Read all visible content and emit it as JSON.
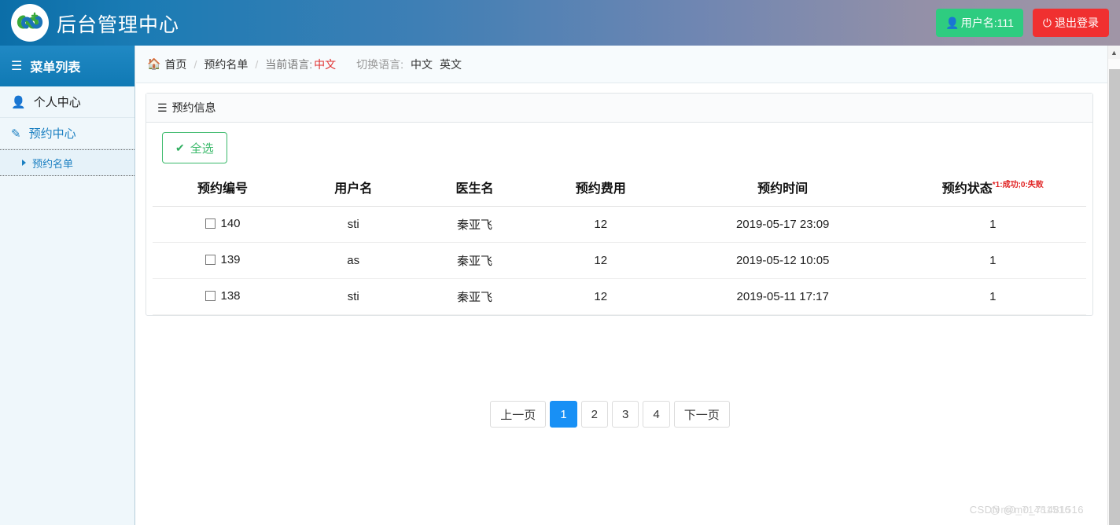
{
  "header": {
    "brand_title": "后台管理中心",
    "logo_icon": "infinity-heart-logo",
    "user_button": {
      "icon": "user-icon",
      "label": "用户名:111",
      "color": "#2ecc80"
    },
    "logout_button": {
      "icon": "power-icon",
      "label": "退出登录",
      "color": "#f03030"
    }
  },
  "sidebar": {
    "head": {
      "icon": "list-icon",
      "label": "菜单列表"
    },
    "items": [
      {
        "icon": "user-icon",
        "label": "个人中心",
        "style": "dark"
      },
      {
        "icon": "edit-icon",
        "label": "预约中心",
        "style": "link"
      }
    ],
    "subitems": [
      {
        "icon": "triangle-right-icon",
        "label": "预约名单"
      }
    ]
  },
  "breadcrumb": {
    "home_icon": "home-icon",
    "home": "首页",
    "separator": "/",
    "page": "预约名单",
    "current_lang_label": "当前语言:",
    "current_lang_value": "中文",
    "switch_lang_label": "切换语言:",
    "lang_links": [
      "中文",
      "英文"
    ]
  },
  "panel": {
    "head_icon": "hamburger-icon",
    "head_title": "预约信息",
    "select_all_button": {
      "icon": "check-icon",
      "label": "全选"
    }
  },
  "table": {
    "columns": [
      "预约编号",
      "用户名",
      "医生名",
      "预约费用",
      "预约时间",
      "预约状态"
    ],
    "status_note": "*1:成功;0:失败",
    "rows": [
      {
        "id": "140",
        "username": "sti",
        "doctor": "秦亚飞",
        "fee": "12",
        "time": "2019-05-17 23:09",
        "status": "1"
      },
      {
        "id": "139",
        "username": "as",
        "doctor": "秦亚飞",
        "fee": "12",
        "time": "2019-05-12 10:05",
        "status": "1"
      },
      {
        "id": "138",
        "username": "sti",
        "doctor": "秦亚飞",
        "fee": "12",
        "time": "2019-05-11 17:17",
        "status": "1"
      }
    ]
  },
  "pagination": {
    "prev_label": "上一页",
    "next_label": "下一页",
    "pages": [
      "1",
      "2",
      "3",
      "4"
    ],
    "active_page": "1",
    "active_color": "#1890f5"
  },
  "scrollbar": {
    "up_arrow": "chevron-up-icon"
  },
  "watermark": {
    "text": "CSDN @m0_71481516",
    "overlay": "@m0_71481516"
  }
}
